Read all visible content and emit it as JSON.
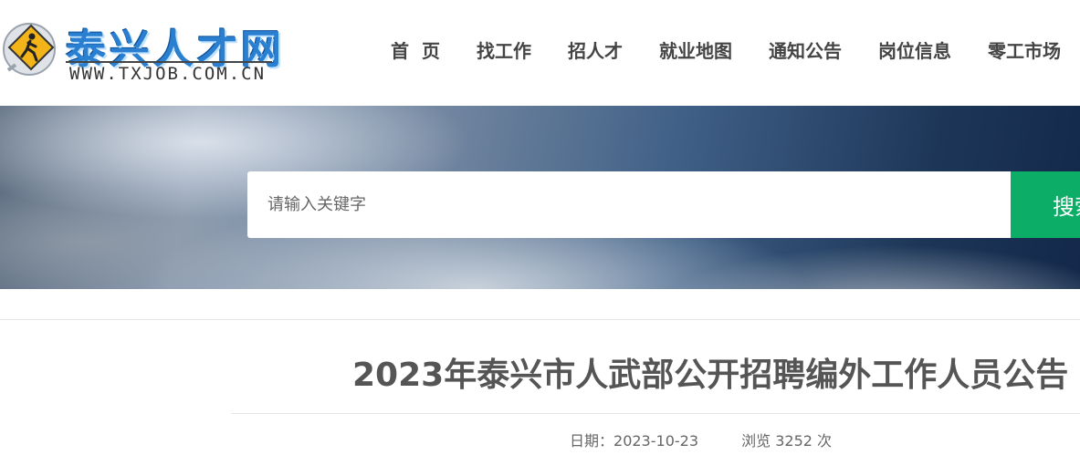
{
  "logo": {
    "title": "泰兴人才网",
    "url": "WWW.TXJOB.COM.CN",
    "icon": "walking-person-sign-icon",
    "colors": {
      "title": "#2b7fd0",
      "badge": "#f2b418"
    }
  },
  "nav": {
    "items": [
      {
        "label": "首页"
      },
      {
        "label": "找工作"
      },
      {
        "label": "招人才"
      },
      {
        "label": "就业地图"
      },
      {
        "label": "通知公告"
      },
      {
        "label": "岗位信息"
      },
      {
        "label": "零工市场"
      }
    ]
  },
  "search": {
    "placeholder": "请输入关键字",
    "value": "",
    "button_label": "搜索",
    "button_color": "#0cae67"
  },
  "article": {
    "title": "2023年泰兴市人武部公开招聘编外工作人员公告",
    "date_label": "日期：",
    "date": "2023-10-23",
    "views_prefix": "浏览",
    "views": "3252",
    "views_suffix": "次"
  }
}
